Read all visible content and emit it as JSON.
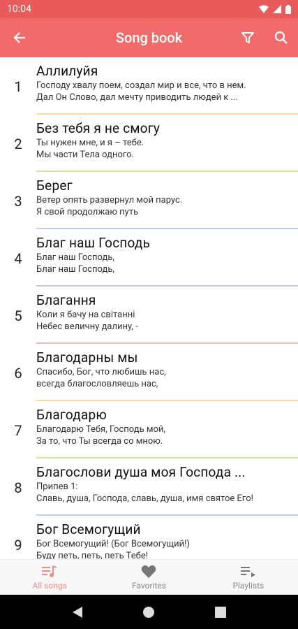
{
  "status_bar": {
    "time": "10:04"
  },
  "app_bar": {
    "title": "Song book"
  },
  "songs": [
    {
      "num": "1",
      "title": "Аллилуйя",
      "line1": "Господу хвалу поем, создал мир и все, что в нем.",
      "line2": "Дал Он Слово, дал мечту приводить людей к ...",
      "color": "#f5d9a8"
    },
    {
      "num": "2",
      "title": "Без тебя я не смогу",
      "line1": "Ты нужен мне, и я – тебе.",
      "line2": "Мы части Тела одного.",
      "color": "#cfe3a4"
    },
    {
      "num": "3",
      "title": "Берег",
      "line1": "Ветер опять  развернул мой парус.",
      "line2": "Я свой  продолжаю путь",
      "color": "#b9cde6"
    },
    {
      "num": "4",
      "title": "Благ наш Господь",
      "line1": "Благ наш Господь,",
      "line2": "Благ наш Господь,",
      "color": "#c8c8e0"
    },
    {
      "num": "5",
      "title": "Благання",
      "line1": "Коли я бачу на світанні",
      "line2": "Небес  величну далину, -",
      "color": "#f3b8b8"
    },
    {
      "num": "6",
      "title": "Благодарны мы",
      "line1": "Спасибо, Бог, что любишь нас,",
      "line2": "всегда благословляешь нас,",
      "color": "#f5d9a8"
    },
    {
      "num": "7",
      "title": "Благодарю",
      "line1": "Благодарю Тебя, Господь мой,",
      "line2": "За то, что Ты всегда со мною.",
      "color": "#cfe3a4"
    },
    {
      "num": "8",
      "title": "Благослови душа моя Господа ...",
      "line1": "Припев 1:",
      "line2": "Славь, душа, Господа, славь, душа,  имя святое Его!",
      "color": "#b9cde6"
    },
    {
      "num": "9",
      "title": "Бог Всемогущий",
      "line1": "Бог Всемогущий! (Бог Всемогущий!)",
      "line2": "Буду петь, петь, петь Тебе!",
      "color": "#c8c8e0"
    }
  ],
  "bottom_nav": {
    "all_songs": "All songs",
    "favorites": "Favorites",
    "playlists": "Playlists"
  },
  "colors": {
    "primary": "#f26b6b",
    "status": "#e95a5a",
    "active_nav": "#f28a8a"
  },
  "icons": [
    "back-arrow-icon",
    "filter-icon",
    "search-icon",
    "all-songs-icon",
    "heart-icon",
    "playlist-icon"
  ]
}
